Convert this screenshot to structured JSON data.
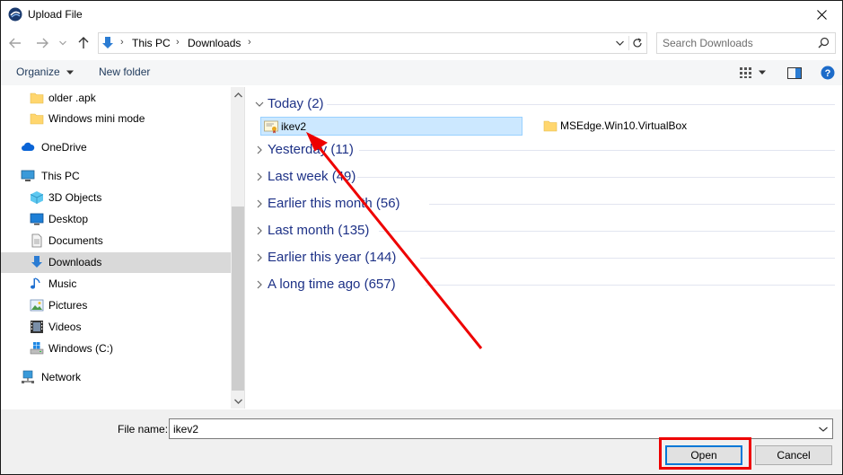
{
  "window": {
    "title": "Upload File"
  },
  "address": {
    "crumbs": [
      "This PC",
      "Downloads"
    ],
    "search_placeholder": "Search Downloads"
  },
  "toolbar": {
    "organize_label": "Organize",
    "new_folder_label": "New folder"
  },
  "nav": {
    "items": [
      {
        "label": "older .apk",
        "icon": "folder-icon"
      },
      {
        "label": "Windows mini mode",
        "icon": "folder-icon"
      },
      {
        "label": "OneDrive",
        "icon": "cloud-icon"
      },
      {
        "label": "This PC",
        "icon": "computer-icon"
      },
      {
        "label": "3D Objects",
        "icon": "cube-icon"
      },
      {
        "label": "Desktop",
        "icon": "desktop-icon"
      },
      {
        "label": "Documents",
        "icon": "document-icon"
      },
      {
        "label": "Downloads",
        "icon": "download-arrow-icon",
        "selected": true
      },
      {
        "label": "Music",
        "icon": "music-note-icon"
      },
      {
        "label": "Pictures",
        "icon": "picture-icon"
      },
      {
        "label": "Videos",
        "icon": "film-icon"
      },
      {
        "label": "Windows (C:)",
        "icon": "drive-icon"
      },
      {
        "label": "Network",
        "icon": "network-icon"
      }
    ]
  },
  "content": {
    "groups": [
      {
        "label": "Today (2)",
        "expanded": true
      },
      {
        "label": "Yesterday (11)",
        "expanded": false
      },
      {
        "label": "Last week (49)",
        "expanded": false
      },
      {
        "label": "Earlier this month (56)",
        "expanded": false
      },
      {
        "label": "Last month (135)",
        "expanded": false
      },
      {
        "label": "Earlier this year (144)",
        "expanded": false
      },
      {
        "label": "A long time ago (657)",
        "expanded": false
      }
    ],
    "today_files": [
      {
        "name": "ikev2",
        "icon": "certificate-file-icon",
        "selected": true
      },
      {
        "name": "MSEdge.Win10.VirtualBox",
        "icon": "folder-icon",
        "selected": false
      }
    ]
  },
  "footer": {
    "file_name_label": "File name:",
    "file_name_value": "ikev2",
    "open_label": "Open",
    "cancel_label": "Cancel"
  },
  "colors": {
    "group_text": "#1e3287",
    "selection_bg": "#cce8ff",
    "annotation_red": "#ee0000",
    "accent_blue": "#0078d7"
  }
}
